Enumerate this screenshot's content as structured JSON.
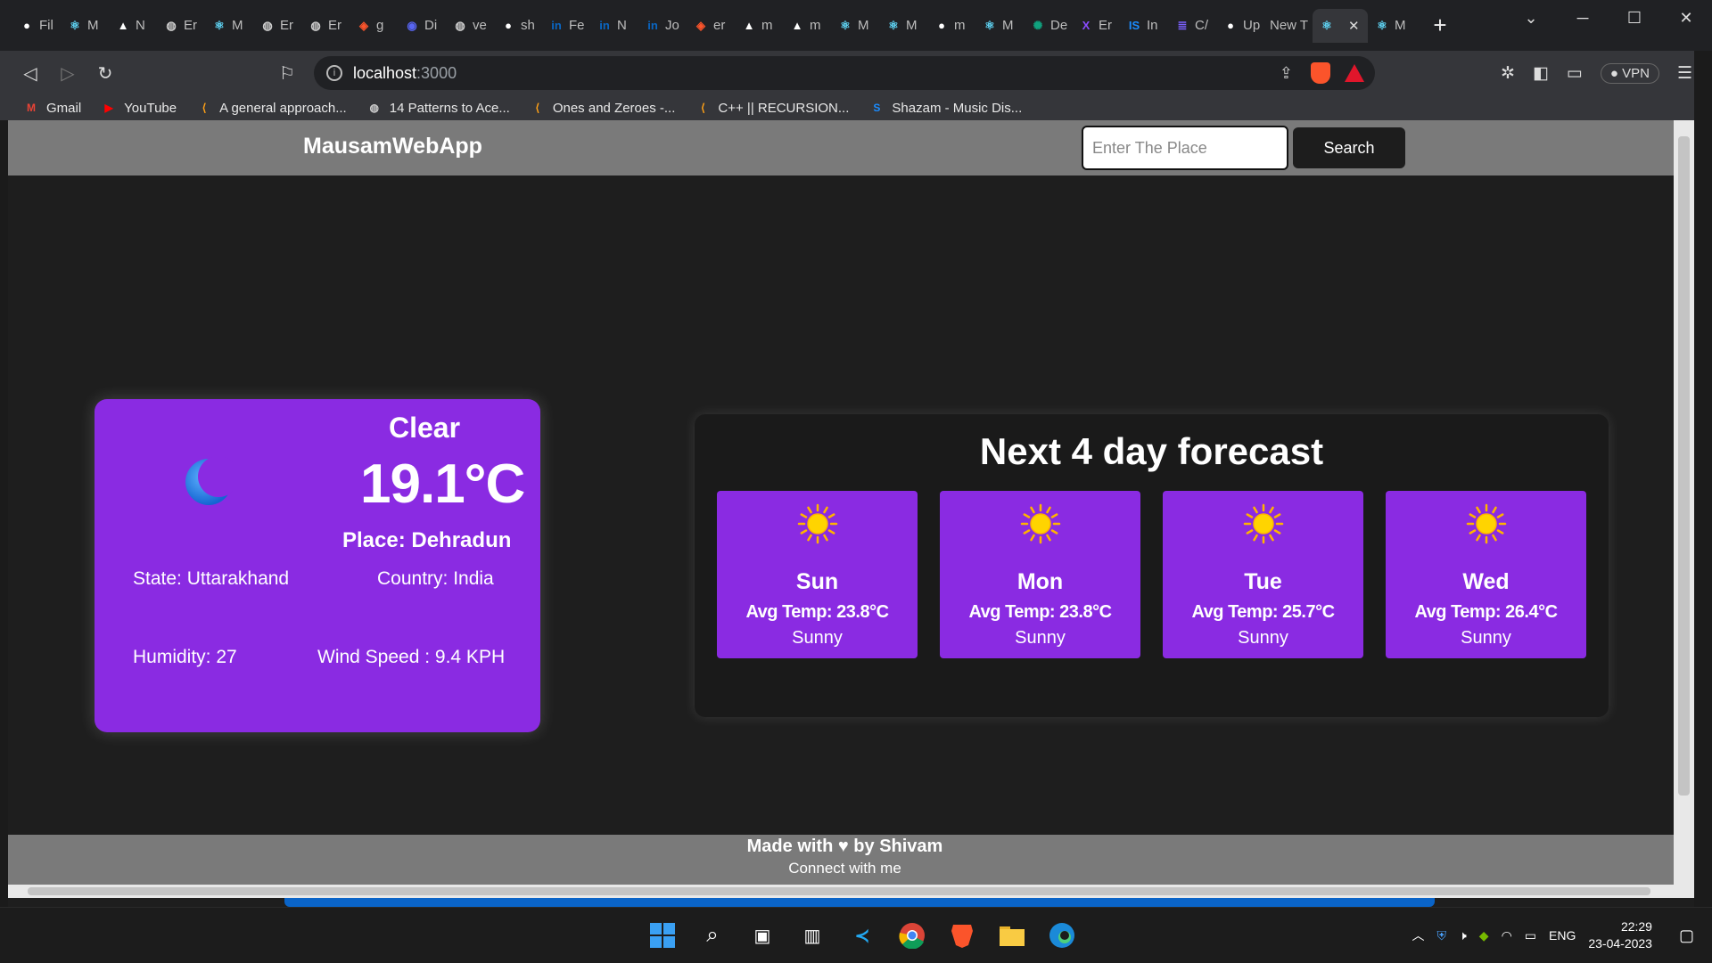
{
  "tabs": [
    {
      "label": "Fil",
      "icon": "github-icon"
    },
    {
      "label": "M",
      "icon": "react-icon"
    },
    {
      "label": "N",
      "icon": "vercel-icon"
    },
    {
      "label": "Er",
      "icon": "globe-icon"
    },
    {
      "label": "M",
      "icon": "react-icon"
    },
    {
      "label": "Er",
      "icon": "globe-icon"
    },
    {
      "label": "Er",
      "icon": "globe-icon"
    },
    {
      "label": "g",
      "icon": "brave-shield-icon"
    },
    {
      "label": "Di",
      "icon": "discord-icon"
    },
    {
      "label": "ve",
      "icon": "globe-icon"
    },
    {
      "label": "sh",
      "icon": "github-icon"
    },
    {
      "label": "Fe",
      "icon": "linkedin-icon"
    },
    {
      "label": "N",
      "icon": "linkedin-icon"
    },
    {
      "label": "Jo",
      "icon": "linkedin-icon"
    },
    {
      "label": "er",
      "icon": "brave-shield-icon"
    },
    {
      "label": "m",
      "icon": "vercel-icon"
    },
    {
      "label": "m",
      "icon": "vercel-icon"
    },
    {
      "label": "M",
      "icon": "react-icon"
    },
    {
      "label": "M",
      "icon": "react-icon"
    },
    {
      "label": "m",
      "icon": "github-icon"
    },
    {
      "label": "M",
      "icon": "react-icon"
    },
    {
      "label": "De",
      "icon": "openai-icon"
    },
    {
      "label": "Er",
      "icon": "x-icon"
    },
    {
      "label": "In",
      "icon": "is-icon"
    },
    {
      "label": "C/",
      "icon": "list-icon"
    },
    {
      "label": "Up",
      "icon": "github-icon"
    },
    {
      "label": "New T",
      "icon": ""
    },
    {
      "label": "",
      "icon": "react-icon",
      "active": true
    },
    {
      "label": "M",
      "icon": "react-icon"
    }
  ],
  "toolbar": {
    "url_host": "localhost",
    "url_port": ":3000",
    "vpn_label": "VPN"
  },
  "bookmarks": [
    {
      "label": "Gmail",
      "icon": "gmail-icon",
      "color": "#ea4335"
    },
    {
      "label": "YouTube",
      "icon": "youtube-icon",
      "color": "#ff0000"
    },
    {
      "label": "A general approach...",
      "icon": "leetcode-icon",
      "color": "#ffa116"
    },
    {
      "label": "14 Patterns to Ace...",
      "icon": "globe-icon",
      "color": "#cccccc"
    },
    {
      "label": "Ones and Zeroes -...",
      "icon": "leetcode-icon",
      "color": "#ffa116"
    },
    {
      "label": "C++ || RECURSION...",
      "icon": "leetcode-icon",
      "color": "#ffa116"
    },
    {
      "label": "Shazam - Music Dis...",
      "icon": "shazam-icon",
      "color": "#1a8cff"
    }
  ],
  "app": {
    "brand": "MausamWebApp",
    "search_placeholder": "Enter The Place",
    "search_button": "Search"
  },
  "current": {
    "condition": "Clear",
    "temp": "19.1°C",
    "place": "Place: Dehradun",
    "state": "State: Uttarakhand",
    "country": "Country: India",
    "humidity": "Humidity: 27",
    "wind": "Wind Speed : 9.4 KPH",
    "icon": "moon-icon"
  },
  "forecast": {
    "title": "Next 4 day forecast",
    "days": [
      {
        "day": "Sun",
        "avg": "Avg Temp: 23.8°C",
        "desc": "Sunny",
        "icon": "sun-icon"
      },
      {
        "day": "Mon",
        "avg": "Avg Temp: 23.8°C",
        "desc": "Sunny",
        "icon": "sun-icon"
      },
      {
        "day": "Tue",
        "avg": "Avg Temp: 25.7°C",
        "desc": "Sunny",
        "icon": "sun-icon"
      },
      {
        "day": "Wed",
        "avg": "Avg Temp: 26.4°C",
        "desc": "Sunny",
        "icon": "sun-icon"
      }
    ]
  },
  "footer": {
    "made_with": "Made with ♥ by Shivam",
    "connect": "Connect with me"
  },
  "tray": {
    "language": "ENG",
    "time": "22:29",
    "date": "23-04-2023"
  },
  "colors": {
    "card_purple": "#8a2be2",
    "nav_gray": "#7a7a7a",
    "page_bg": "#1e1e1e"
  }
}
